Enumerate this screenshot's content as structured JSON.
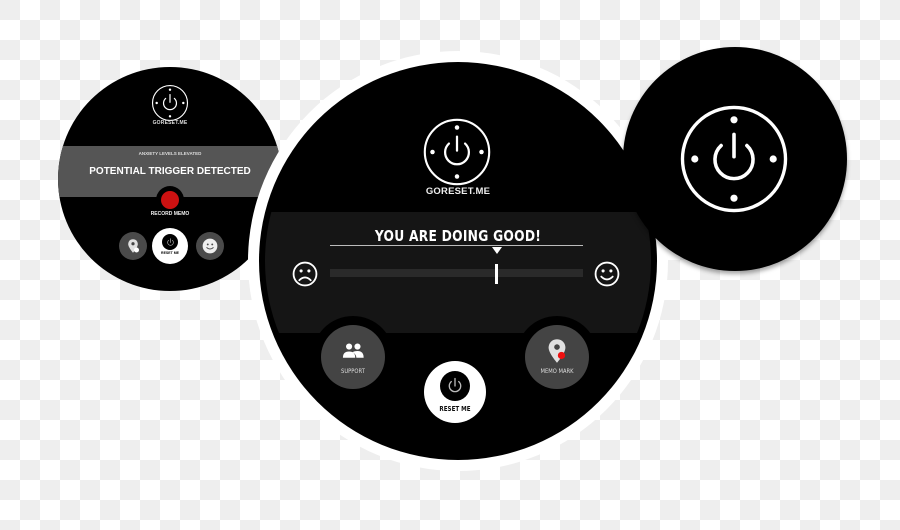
{
  "brand": "GORESET.ME",
  "theme": {
    "watch_face": "#000000",
    "alert_band": "#555555",
    "status_band": "#151515",
    "button_gray": "#444444",
    "record_red": "#cc1111",
    "marker_red": "#ee1111",
    "text": "#ffffff"
  },
  "left_watch": {
    "brand": "GORESET.ME",
    "alert_subtitle": "ANXIETY LEVELS ELEVATED",
    "alert_title": "POTENTIAL TRIGGER DETECTED",
    "record_label": "RECORD MEMO",
    "buttons": [
      {
        "name": "memo-mark",
        "icon": "map-pin-icon"
      },
      {
        "name": "reset-me",
        "label": "RESET ME",
        "icon": "power-icon"
      },
      {
        "name": "mood",
        "icon": "smiley-icon"
      }
    ]
  },
  "middle_watch": {
    "brand": "GORESET.ME",
    "status": "YOU ARE DOING GOOD!",
    "mood_slider": {
      "value": 0.66,
      "min_icon": "sad-face-icon",
      "max_icon": "happy-face-icon"
    },
    "buttons": {
      "support": {
        "label": "SUPPORT",
        "icon": "people-icon"
      },
      "reset": {
        "label": "RESET ME",
        "icon": "power-icon"
      },
      "memo_mark": {
        "label": "MEMO MARK",
        "icon": "map-pin-icon"
      }
    }
  },
  "right_watch": {
    "logo_icon": "power-icon"
  }
}
